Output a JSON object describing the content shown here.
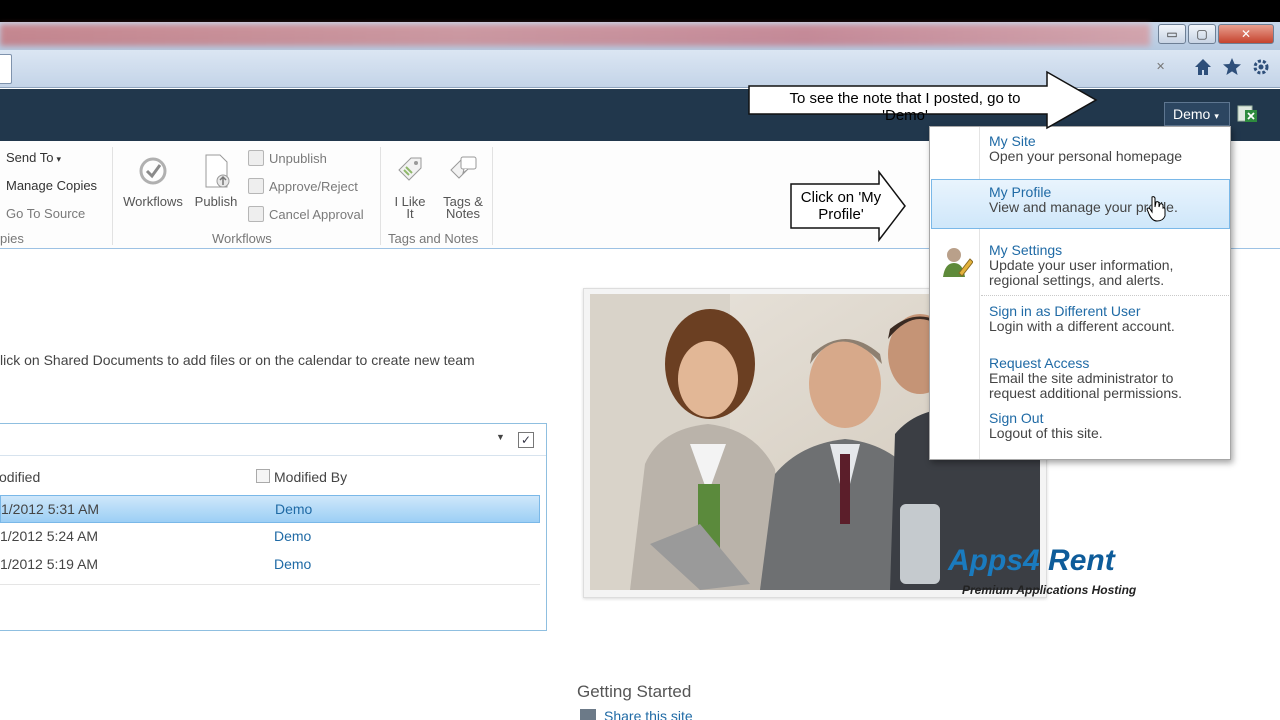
{
  "browser": {
    "window_buttons": {
      "minimize": "▭",
      "maximize": "▢",
      "close": "✕"
    },
    "icons": {
      "home": "home-icon",
      "favorites": "star-icon",
      "tools": "gear-icon"
    },
    "address_clear": "✕"
  },
  "topbar": {
    "user_name": "Demo",
    "user_caret": "▾"
  },
  "ribbon": {
    "copies": {
      "send_to": "Send To",
      "manage_copies": "Manage Copies",
      "go_to_source": "Go To Source",
      "group_label": "pies"
    },
    "workflows": {
      "workflows": "Workflows",
      "publish": "Publish",
      "unpublish": "Unpublish",
      "approve_reject": "Approve/Reject",
      "cancel_approval": "Cancel Approval",
      "group_label": "Workflows"
    },
    "tags": {
      "i_like_it_1": "I Like",
      "i_like_it_2": "It",
      "tags_notes_1": "Tags &",
      "tags_notes_2": "Notes",
      "group_label": "Tags and Notes"
    }
  },
  "content": {
    "intro": "lick on Shared Documents to add files or on the calendar to create new team",
    "docs": {
      "col_modified": "odified",
      "col_modified_by": "Modified By",
      "select_all": "✓",
      "rows": [
        {
          "date": "1/2012 5:31 AM",
          "author": "Demo",
          "selected": true
        },
        {
          "date": "1/2012 5:24 AM",
          "author": "Demo",
          "selected": false
        },
        {
          "date": "1/2012 5:19 AM",
          "author": "Demo",
          "selected": false
        }
      ]
    },
    "logo": {
      "apps": "Apps",
      "four": "4",
      "rent": "Rent",
      "tagline": "Premium Applications Hosting"
    },
    "getting_started": "Getting Started",
    "share_site": "Share this site"
  },
  "dropdown": {
    "items": [
      {
        "title": "My Site",
        "desc1": "Open your personal homepage",
        "desc2": ""
      },
      {
        "title": "My Profile",
        "desc1": "View and manage your profile.",
        "desc2": ""
      },
      {
        "title": "My Settings",
        "desc1": "Update your user information,",
        "desc2": "regional settings, and alerts."
      },
      {
        "title": "Sign in as Different User",
        "desc1": "Login with a different account.",
        "desc2": ""
      },
      {
        "title": "Request Access",
        "desc1": "Email the site administrator to",
        "desc2": "request additional permissions."
      },
      {
        "title": "Sign Out",
        "desc1": "Logout of this site.",
        "desc2": ""
      }
    ]
  },
  "callouts": {
    "top_line1": "To see the note that I posted, go to",
    "top_line2": "'Demo'",
    "side_line1": "Click on 'My",
    "side_line2": "Profile'"
  },
  "colors": {
    "topbar": "#21374c",
    "link": "#1f6aa5",
    "hover": "#cfe7fa"
  }
}
